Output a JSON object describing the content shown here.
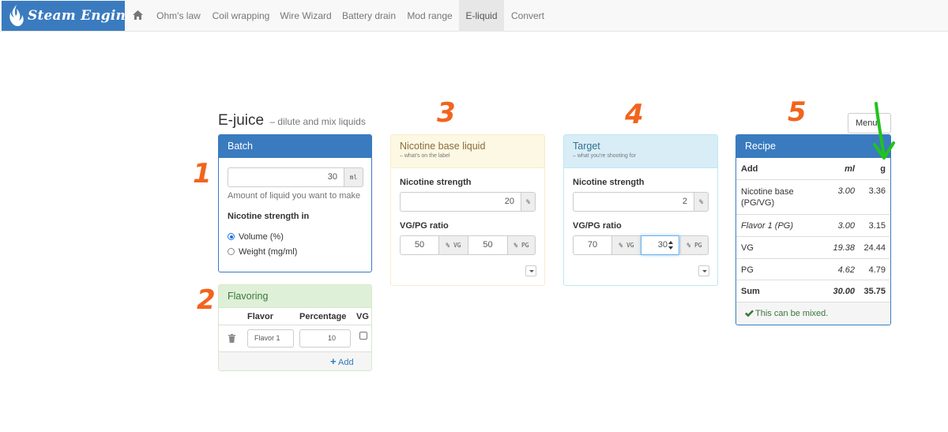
{
  "navbar": {
    "brand": "Steam Engine",
    "items": [
      {
        "label": "Ohm's law"
      },
      {
        "label": "Coil wrapping"
      },
      {
        "label": "Wire Wizard"
      },
      {
        "label": "Battery drain"
      },
      {
        "label": "Mod range"
      },
      {
        "label": "E-liquid",
        "active": true
      },
      {
        "label": "Convert"
      }
    ]
  },
  "page": {
    "title": "E-juice",
    "subtitle": "– dilute and mix liquids",
    "menu_label": "Menu"
  },
  "batch": {
    "title": "Batch",
    "amount_value": "30",
    "amount_unit": "ml",
    "amount_help": "Amount of liquid you want to make",
    "strength_in_label": "Nicotine strength in",
    "options": [
      {
        "label": "Volume (%)",
        "checked": true
      },
      {
        "label": "Weight (mg/ml)",
        "checked": false
      }
    ]
  },
  "nicotine_base": {
    "title": "Nicotine base liquid",
    "subtitle": "– what's on the label",
    "strength_label": "Nicotine strength",
    "strength_value": "20",
    "strength_unit": "%",
    "ratio_label": "VG/PG ratio",
    "vg_value": "50",
    "vg_unit": "% VG",
    "pg_value": "50",
    "pg_unit": "% PG"
  },
  "target": {
    "title": "Target",
    "subtitle": "– what you're shooting for",
    "strength_label": "Nicotine strength",
    "strength_value": "2",
    "strength_unit": "%",
    "ratio_label": "VG/PG ratio",
    "vg_value": "70",
    "vg_unit": "% VG",
    "pg_value": "30",
    "pg_unit": "% PG"
  },
  "flavoring": {
    "title": "Flavoring",
    "columns": [
      "Flavor",
      "Percentage",
      "VG"
    ],
    "rows": [
      {
        "name": "Flavor 1",
        "percentage": "10",
        "vg": false
      }
    ],
    "add_label": "Add"
  },
  "recipe": {
    "title": "Recipe",
    "columns": [
      "Add",
      "ml",
      "g"
    ],
    "rows": [
      {
        "name": "Nicotine base (PG/VG)",
        "ml": "3.00",
        "g": "3.36"
      },
      {
        "name": "Flavor 1 (PG)",
        "ml": "3.00",
        "g": "3.15"
      },
      {
        "name": "VG",
        "ml": "19.38",
        "g": "24.44"
      },
      {
        "name": "PG",
        "ml": "4.62",
        "g": "4.79"
      },
      {
        "name": "Sum",
        "ml": "30.00",
        "g": "35.75"
      }
    ],
    "status": "This can be mixed.",
    "status_color": "#3c763d"
  },
  "annotations": {
    "n1": "1",
    "n2": "2",
    "n3": "3",
    "n4": "4",
    "n5": "5",
    "color": "#f2641e",
    "arrow_color": "#22c21e"
  }
}
